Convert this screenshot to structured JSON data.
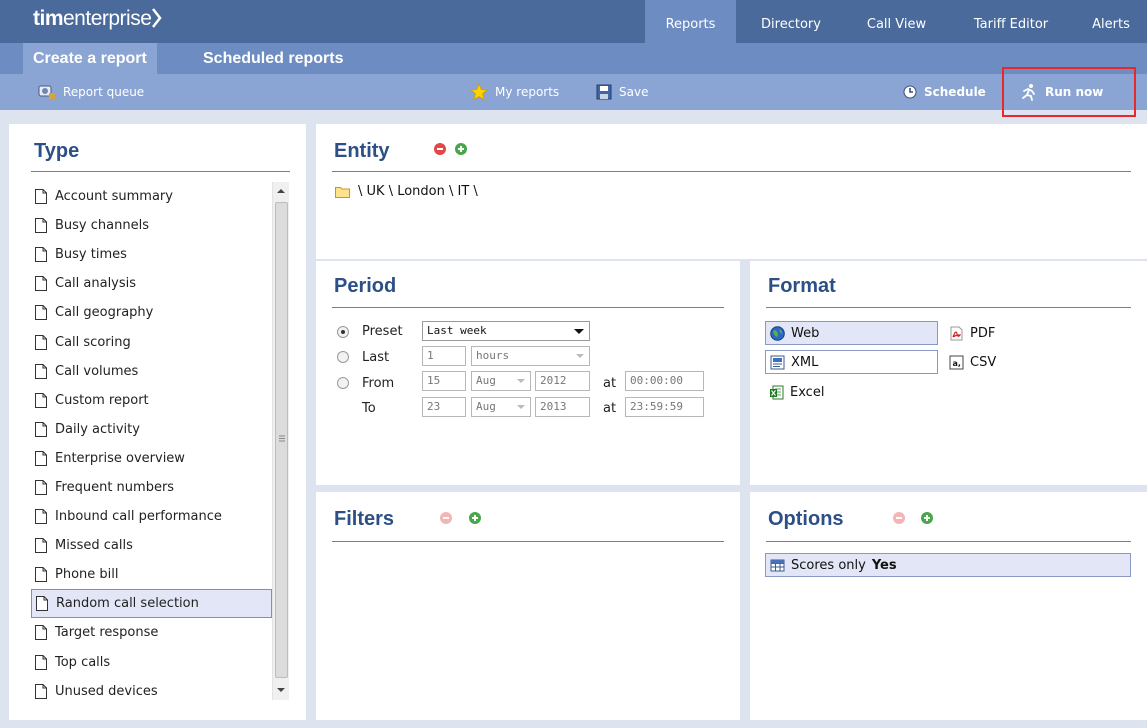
{
  "app": {
    "logo_bold": "tim",
    "logo_rest": "enterprise"
  },
  "nav": {
    "tabs": [
      {
        "label": "Reports"
      },
      {
        "label": "Directory"
      },
      {
        "label": "Call View"
      },
      {
        "label": "Tariff Editor"
      },
      {
        "label": "Alerts"
      }
    ]
  },
  "subnav": {
    "create": "Create a report",
    "scheduled": "Scheduled reports"
  },
  "toolbar": {
    "queue": "Report queue",
    "myreports": "My reports",
    "save": "Save",
    "schedule": "Schedule",
    "run": "Run now"
  },
  "type": {
    "title": "Type",
    "selected": "Random call selection",
    "items": [
      "Account summary",
      "Busy channels",
      "Busy times",
      "Call analysis",
      "Call geography",
      "Call scoring",
      "Call volumes",
      "Custom report",
      "Daily activity",
      "Enterprise overview",
      "Frequent numbers",
      "Inbound call performance",
      "Missed calls",
      "Phone bill",
      "Random call selection",
      "Target response",
      "Top calls",
      "Unused devices"
    ]
  },
  "entity": {
    "title": "Entity",
    "path": "\\ UK \\ London \\ IT \\"
  },
  "period": {
    "title": "Period",
    "selected_option": "Preset",
    "preset": {
      "label": "Preset",
      "value": "Last week"
    },
    "last": {
      "label": "Last",
      "count": "1",
      "unit": "hours"
    },
    "from": {
      "label": "From",
      "day": "15",
      "month": "Aug",
      "year": "2012",
      "at": "at",
      "time": "00:00:00"
    },
    "to": {
      "label": "To",
      "day": "23",
      "month": "Aug",
      "year": "2013",
      "at": "at",
      "time": "23:59:59"
    }
  },
  "format": {
    "title": "Format",
    "selected": "Web",
    "web": "Web",
    "pdf": "PDF",
    "xml": "XML",
    "csv": "CSV",
    "excel": "Excel"
  },
  "filters": {
    "title": "Filters"
  },
  "options": {
    "title": "Options",
    "scores_label": "Scores only",
    "scores_value": "Yes"
  },
  "colors": {
    "accent": "#2c4f86",
    "topbar": "#496a9a",
    "highlight": "#e8282b"
  }
}
